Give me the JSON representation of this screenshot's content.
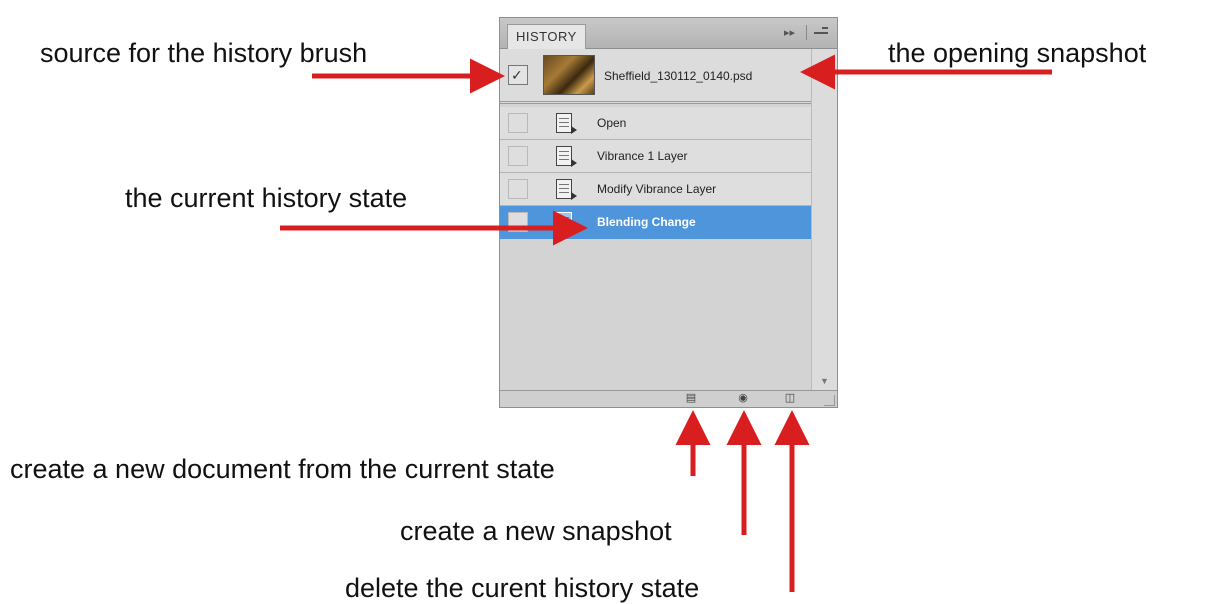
{
  "annotations": {
    "source": "source for the history brush",
    "opening": "the opening snapshot",
    "current": "the current history state",
    "new_document": "create a new document from the current state",
    "new_snapshot": "create a new snapshot",
    "delete_state": "delete the curent history state"
  },
  "panel": {
    "tab_label": "HISTORY",
    "snapshot": {
      "label": "Sheffield_130112_0140.psd"
    },
    "states": [
      {
        "label": "Open",
        "selected": false
      },
      {
        "label": "Vibrance 1 Layer",
        "selected": false
      },
      {
        "label": "Modify Vibrance Layer",
        "selected": false
      },
      {
        "label": "Blending Change",
        "selected": true
      }
    ],
    "icons": {
      "collapse": "double-arrow-icon",
      "menu": "panel-menu-icon",
      "new_document": "new-document-icon",
      "new_snapshot": "camera-icon",
      "delete": "trash-icon"
    }
  },
  "colors": {
    "arrow": "#d81e1e",
    "selection": "#4f95db"
  }
}
